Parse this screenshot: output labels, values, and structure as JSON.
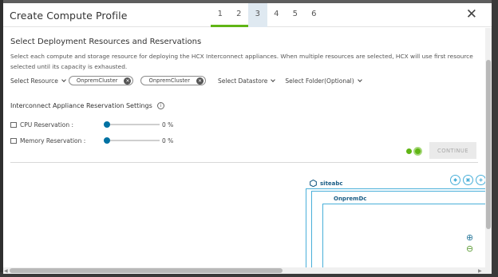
{
  "modal": {
    "title": "Create Compute Profile",
    "steps": [
      "1",
      "2",
      "3",
      "4",
      "5",
      "6"
    ],
    "close_icon": "close-icon"
  },
  "section": {
    "title": "Select Deployment Resources and Reservations",
    "description": "Select each compute and storage resource for deploying the HCX Interconnect appliances. When multiple resources are selected, HCX will use first resource selected until its capacity is exhausted."
  },
  "resources": {
    "select_resource_label": "Select Resource",
    "chips": [
      "OnpremCluster",
      "OnpremCluster"
    ],
    "select_datastore_label": "Select Datastore",
    "select_folder_label": "Select Folder(Optional)"
  },
  "reservation": {
    "title": "Interconnect Appliance Reservation Settings",
    "cpu_label": "CPU Reservation :",
    "cpu_value": "0 %",
    "cpu_fraction": 0,
    "memory_label": "Memory Reservation :",
    "memory_value": "0 %",
    "memory_fraction": 0
  },
  "actions": {
    "continue_label": "CONTINUE"
  },
  "topology": {
    "site_label": "siteabc",
    "dc_label": "OnpremDc"
  },
  "colors": {
    "accent": "#0072a3",
    "done_step": "#60b515",
    "topology_border": "#49afd9"
  }
}
